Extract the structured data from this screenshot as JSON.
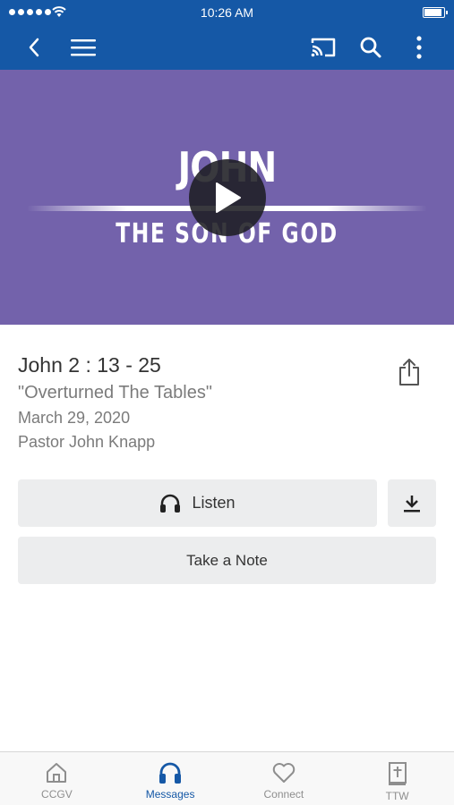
{
  "status_bar": {
    "time": "10:26 AM"
  },
  "hero": {
    "title_top": "JOHN",
    "title_bottom": "THE SON OF GOD",
    "background_color": "#7362ab"
  },
  "message": {
    "passage": "John 2 : 13 - 25",
    "title": "\"Overturned The Tables\"",
    "date": "March 29, 2020",
    "speaker": "Pastor John Knapp"
  },
  "actions": {
    "listen_label": "Listen",
    "note_label": "Take a Note"
  },
  "tabs": [
    {
      "label": "CCGV",
      "icon": "home-icon",
      "active": false
    },
    {
      "label": "Messages",
      "icon": "headphones-icon",
      "active": true
    },
    {
      "label": "Connect",
      "icon": "heart-icon",
      "active": false
    },
    {
      "label": "TTW",
      "icon": "bible-icon",
      "active": false
    }
  ],
  "colors": {
    "brand": "#1558a6",
    "button_bg": "#ecedee",
    "inactive_tab": "#8e8e8e"
  }
}
